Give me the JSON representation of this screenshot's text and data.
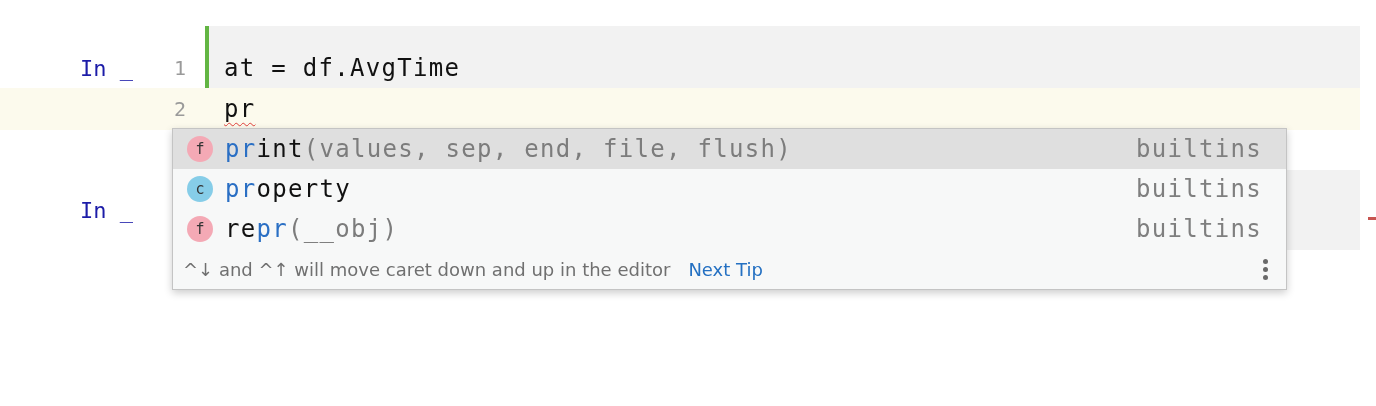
{
  "cells": [
    {
      "prompt": "In _",
      "selected": true,
      "lines": [
        {
          "number": "1",
          "code": "at = df.AvgTime",
          "current": false,
          "misspelled": false
        },
        {
          "number": "2",
          "code": "pr",
          "current": true,
          "misspelled": true
        }
      ]
    },
    {
      "prompt": "In _",
      "selected": false,
      "error_marker": true
    }
  ],
  "completion": {
    "items": [
      {
        "icon": "f",
        "color": "#f4a9b5",
        "parts": [
          {
            "text": "pr",
            "match": true
          },
          {
            "text": "int",
            "match": false
          }
        ],
        "params": "(values, sep, end, file, flush)",
        "source": "builtins",
        "selected": true
      },
      {
        "icon": "c",
        "color": "#86cde8",
        "parts": [
          {
            "text": "pr",
            "match": true
          },
          {
            "text": "operty",
            "match": false
          }
        ],
        "source": "builtins",
        "selected": false
      },
      {
        "icon": "f",
        "color": "#f4a9b5",
        "parts": [
          {
            "text": "re",
            "match": false
          },
          {
            "text": "pr",
            "match": true
          }
        ],
        "params": "(__obj)",
        "source": "builtins",
        "selected": false
      }
    ],
    "tip": "^↓ and ^↑ will move caret down and up in the editor",
    "tip_link": "Next Tip"
  }
}
